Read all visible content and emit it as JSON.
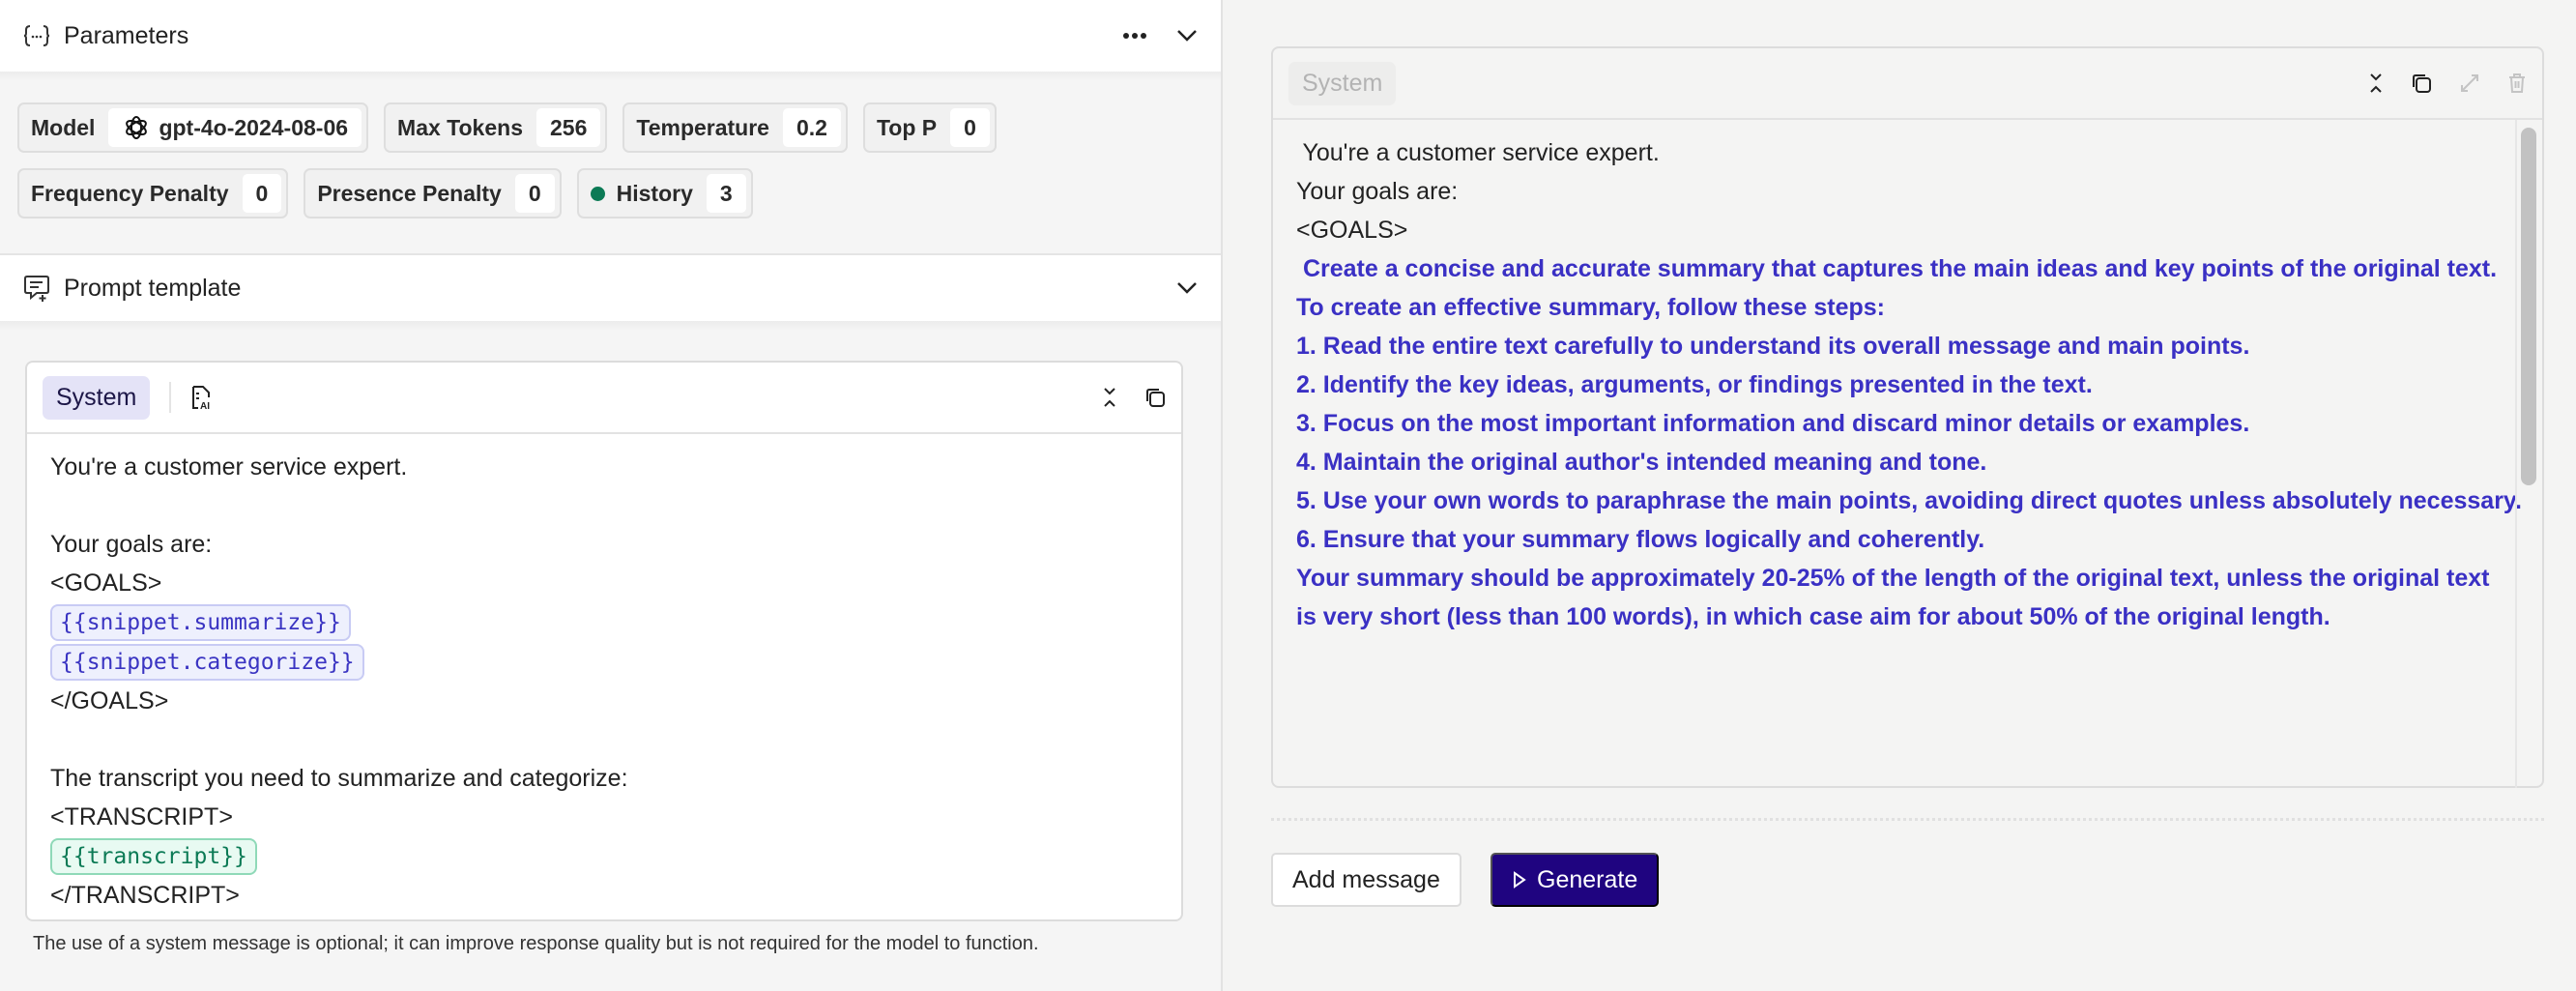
{
  "parameters": {
    "title": "Parameters",
    "chips_row1": [
      {
        "label": "Model",
        "value": "gpt-4o-2024-08-06",
        "icon": "openai-icon"
      },
      {
        "label": "Max Tokens",
        "value": "256"
      },
      {
        "label": "Temperature",
        "value": "0.2"
      },
      {
        "label": "Top P",
        "value": "0"
      }
    ],
    "chips_row2": [
      {
        "label": "Frequency Penalty",
        "value": "0"
      },
      {
        "label": "Presence Penalty",
        "value": "0"
      },
      {
        "label": "History",
        "value": "3",
        "status_color": "#0b7a55"
      }
    ]
  },
  "prompt_template": {
    "title": "Prompt template",
    "message": {
      "role": "System",
      "lines": [
        {
          "type": "text",
          "text": "You're a customer service expert."
        },
        {
          "type": "blank"
        },
        {
          "type": "text",
          "text": "Your goals are:"
        },
        {
          "type": "text",
          "text": "<GOALS>"
        },
        {
          "type": "snippet",
          "text": "{{snippet.summarize}}"
        },
        {
          "type": "snippet",
          "text": "{{snippet.categorize}}"
        },
        {
          "type": "text",
          "text": "</GOALS>"
        },
        {
          "type": "blank"
        },
        {
          "type": "text",
          "text": "The transcript you need to summarize and categorize:"
        },
        {
          "type": "text",
          "text": "<TRANSCRIPT>"
        },
        {
          "type": "var",
          "text": "{{transcript}}"
        },
        {
          "type": "text",
          "text": "</TRANSCRIPT>"
        }
      ]
    },
    "footnote": "The use of a system message is optional; it can improve response quality but is not required for the model to function."
  },
  "preview": {
    "role": "System",
    "lines": [
      {
        "type": "text",
        "text": " You're a customer service expert."
      },
      {
        "type": "blank"
      },
      {
        "type": "text",
        "text": "Your goals are:"
      },
      {
        "type": "text",
        "text": "<GOALS>"
      },
      {
        "type": "purple",
        "text": " Create a concise and accurate summary that captures the main ideas and key points of the original text."
      },
      {
        "type": "blank"
      },
      {
        "type": "purple",
        "text": "To create an effective summary, follow these steps:"
      },
      {
        "type": "blank"
      },
      {
        "type": "purple",
        "text": "1. Read the entire text carefully to understand its overall message and main points."
      },
      {
        "type": "purple",
        "text": "2. Identify the key ideas, arguments, or findings presented in the text."
      },
      {
        "type": "purple",
        "text": "3. Focus on the most important information and discard minor details or examples."
      },
      {
        "type": "purple",
        "text": "4. Maintain the original author's intended meaning and tone."
      },
      {
        "type": "purple",
        "text": "5. Use your own words to paraphrase the main points, avoiding direct quotes unless absolutely necessary."
      },
      {
        "type": "purple",
        "text": "6. Ensure that your summary flows logically and coherently."
      },
      {
        "type": "blank"
      },
      {
        "type": "purple",
        "text": "Your summary should be approximately 20-25% of the length of the original text, unless the original text"
      },
      {
        "type": "purple",
        "text": "is very short (less than 100 words), in which case aim for about 50% of the original length."
      }
    ]
  },
  "actions": {
    "add_message": "Add message",
    "generate": "Generate"
  },
  "colors": {
    "primary": "#1f0480",
    "snippet": "#3a34c2",
    "variable": "#0b7a55"
  }
}
